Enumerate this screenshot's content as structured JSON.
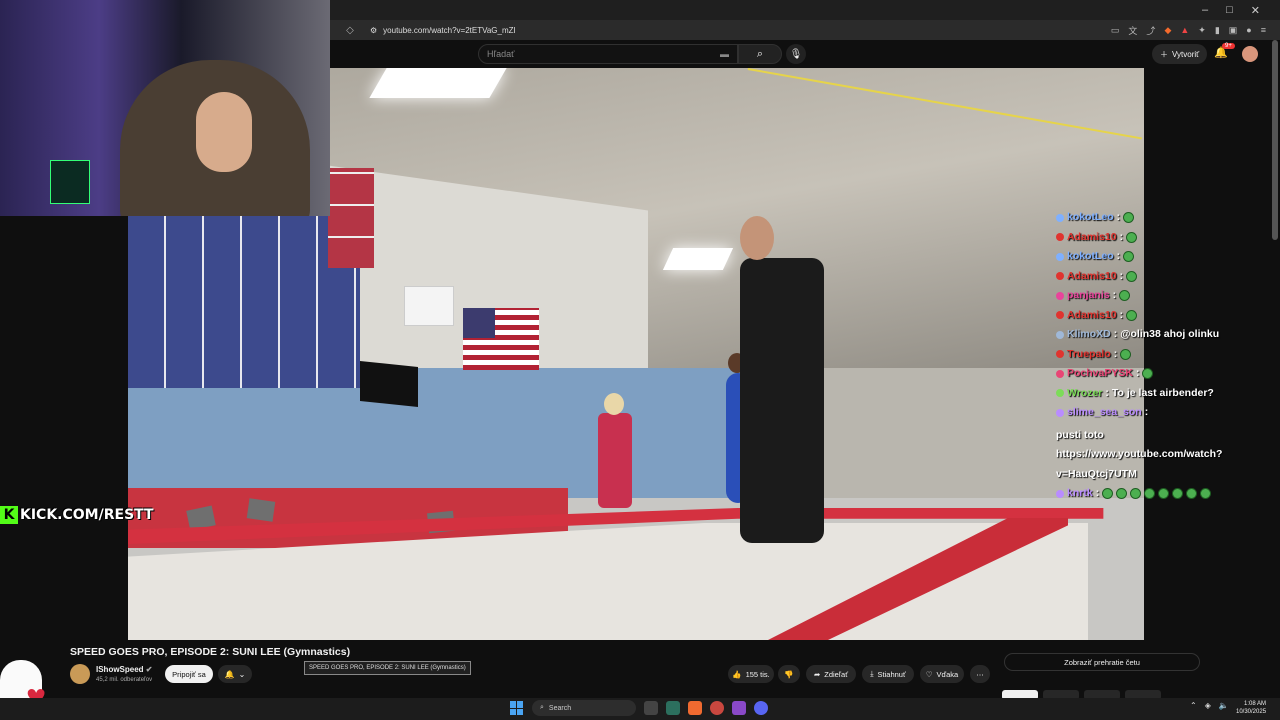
{
  "browser": {
    "url": "youtube.com/watch?v=2tETVaG_mZI",
    "window_controls": [
      "–",
      "□",
      "✕"
    ]
  },
  "youtube": {
    "search_placeholder": "Hľadať",
    "create_label": "Vytvoriť",
    "notification_count": "9+"
  },
  "overlay": {
    "kick_label": "KICK.COM/RESTT"
  },
  "chat": {
    "lines": [
      {
        "user": "kokotLeo",
        "user_color": "#7fb0ff",
        "text": "",
        "emotes": 1
      },
      {
        "user": "Adamis10",
        "user_color": "#e0342f",
        "text": "",
        "emotes": 1
      },
      {
        "user": "kokotLeo",
        "user_color": "#7fb0ff",
        "text": "",
        "emotes": 1
      },
      {
        "user": "Adamis10",
        "user_color": "#e0342f",
        "text": "",
        "emotes": 1
      },
      {
        "user": "panjanis",
        "user_color": "#e8449b",
        "text": "",
        "emotes": 1
      },
      {
        "user": "Adamis10",
        "user_color": "#e0342f",
        "text": "",
        "emotes": 1
      },
      {
        "user": "KlimoXD",
        "user_color": "#9fb8d8",
        "text": "@olin38 ahoj olinku",
        "emotes": 0
      },
      {
        "user": "Truepalo",
        "user_color": "#e0342f",
        "text": "",
        "emotes": 1
      },
      {
        "user": "PochvaPYSK",
        "user_color": "#e84575",
        "text": "",
        "emotes": 1
      },
      {
        "user": "Wrozer",
        "user_color": "#7cdc58",
        "text": "To je last airbender?",
        "emotes": 0
      },
      {
        "user": "slime_sea_son",
        "user_color": "#b98cff",
        "text": "pusti toto https://www.youtube.com/watch?v=HauQtcj7UTM",
        "emotes": 0
      },
      {
        "user": "knrtk",
        "user_color": "#b98cff",
        "text": "",
        "emotes": 8
      }
    ]
  },
  "video": {
    "title": "SPEED GOES PRO, EPISODE 2: SUNI LEE (Gymnastics)",
    "tooltip": "SPEED GOES PRO, EPISODE 2: SUNI LEE (Gymnastics)",
    "channel": "IShowSpeed",
    "subscribers": "45,2 mil. odberateľov",
    "join_label": "Pripojiť sa",
    "likes": "155 tis.",
    "share_label": "Zdieľať",
    "download_label": "Stiahnuť",
    "thanks_label": "Vďaka",
    "show_chat_label": "Zobraziť prehratie četu"
  },
  "taskbar": {
    "search_label": "Search",
    "time": "1:08 AM",
    "date": "10/30/2025"
  }
}
